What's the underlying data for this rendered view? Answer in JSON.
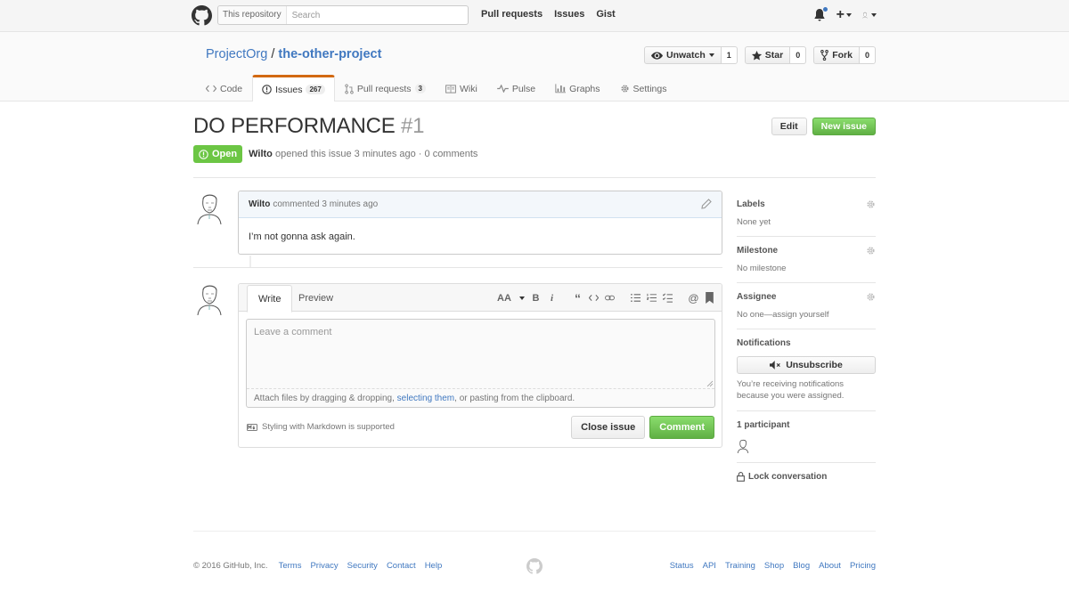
{
  "header": {
    "scope_label": "This repository",
    "search_placeholder": "Search",
    "nav": [
      "Pull requests",
      "Issues",
      "Gist"
    ]
  },
  "repo": {
    "owner": "ProjectOrg",
    "separator": " / ",
    "name": "the-other-project",
    "watch": {
      "label": "Unwatch",
      "count": "1"
    },
    "star": {
      "label": "Star",
      "count": "0"
    },
    "fork": {
      "label": "Fork",
      "count": "0"
    },
    "tabs": [
      {
        "label": "Code",
        "icon": "code-icon"
      },
      {
        "label": "Issues",
        "icon": "issue-opened-icon",
        "counter": "267",
        "selected": true
      },
      {
        "label": "Pull requests",
        "icon": "git-pull-request-icon",
        "counter": "3"
      },
      {
        "label": "Wiki",
        "icon": "book-icon"
      },
      {
        "label": "Pulse",
        "icon": "pulse-icon"
      },
      {
        "label": "Graphs",
        "icon": "graph-icon"
      },
      {
        "label": "Settings",
        "icon": "gear-icon"
      }
    ]
  },
  "issue": {
    "title": "DO PERFORMANCE",
    "number": "#1",
    "edit_label": "Edit",
    "new_issue_label": "New issue",
    "state": "Open",
    "author": "Wilto",
    "meta_text": "opened this issue 3 minutes ago · 0 comments"
  },
  "comment": {
    "author": "Wilto",
    "time": "commented 3 minutes ago",
    "body": "I’m not gonna ask again."
  },
  "editor": {
    "write_tab": "Write",
    "preview_tab": "Preview",
    "placeholder": "Leave a comment",
    "attach_prefix": "Attach files by dragging & dropping, ",
    "attach_link": "selecting them",
    "attach_suffix": ", or pasting from the clipboard.",
    "markdown_note": "Styling with Markdown is supported",
    "close_label": "Close issue",
    "comment_label": "Comment"
  },
  "sidebar": {
    "labels_title": "Labels",
    "labels_value": "None yet",
    "milestone_title": "Milestone",
    "milestone_value": "No milestone",
    "assignee_title": "Assignee",
    "assignee_value": "No one—assign yourself",
    "notifications_title": "Notifications",
    "unsubscribe_label": "Unsubscribe",
    "notifications_note": "You’re receiving notifications because you were assigned.",
    "participants_title": "1 participant",
    "lock_label": "Lock conversation"
  },
  "footer": {
    "copyright": "© 2016 GitHub, Inc.",
    "left_links": [
      "Terms",
      "Privacy",
      "Security",
      "Contact",
      "Help"
    ],
    "right_links": [
      "Status",
      "API",
      "Training",
      "Shop",
      "Blog",
      "About",
      "Pricing"
    ]
  },
  "colors": {
    "link": "#4078c0",
    "open_state": "#6cc644",
    "primary_button": "#60b044",
    "selected_tab_accent": "#d26911"
  }
}
